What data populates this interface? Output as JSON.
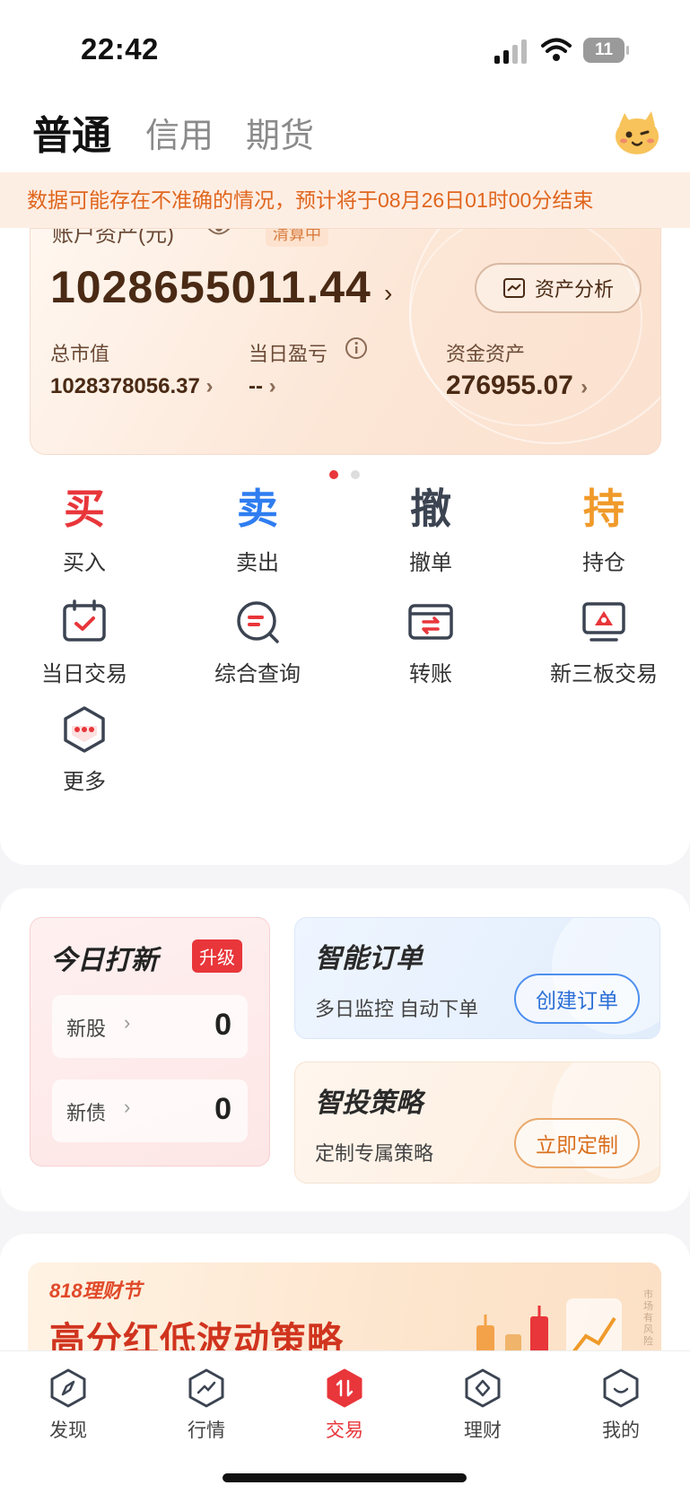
{
  "status_bar": {
    "time": "22:42",
    "battery": "11"
  },
  "top_tabs": [
    {
      "label": "普通",
      "active": true
    },
    {
      "label": "信用",
      "active": false
    },
    {
      "label": "期货",
      "active": false
    }
  ],
  "notice": "数据可能存在不准确的情况，预计将于08月26日01时00分结束",
  "asset_card": {
    "label": "账户资产(元)",
    "clearing_badge": "清算中",
    "total": "1028655011.44",
    "analysis_button": "资产分析",
    "stats": [
      {
        "label": "总市值",
        "value": "1028378056.37"
      },
      {
        "label": "当日盈亏",
        "value": "--"
      },
      {
        "label": "资金资产",
        "value": "276955.07"
      }
    ]
  },
  "pager": {
    "count": 2,
    "active_index": 0
  },
  "trade_actions": [
    {
      "glyph": "买",
      "label": "买入",
      "color": "#e8363a"
    },
    {
      "glyph": "卖",
      "label": "卖出",
      "color": "#2f7df0"
    },
    {
      "glyph": "撤",
      "label": "撤单",
      "color": "#3c4452"
    },
    {
      "glyph": "持",
      "label": "持仓",
      "color": "#f09a2a"
    }
  ],
  "functions": [
    {
      "label": "当日交易",
      "icon": "calendar-check-icon"
    },
    {
      "label": "综合查询",
      "icon": "search-query-icon"
    },
    {
      "label": "转账",
      "icon": "transfer-card-icon"
    },
    {
      "label": "新三板交易",
      "icon": "monitor-chart-icon"
    },
    {
      "label": "更多",
      "icon": "more-hexagon-icon"
    }
  ],
  "ipo_card": {
    "title": "今日打新",
    "badge": "升级",
    "rows": [
      {
        "label": "新股",
        "count": "0"
      },
      {
        "label": "新债",
        "count": "0"
      }
    ]
  },
  "smart_order": {
    "title": "智能订单",
    "subtitle": "多日监控 自动下单",
    "button": "创建订单"
  },
  "smart_strategy": {
    "title": "智投策略",
    "subtitle": "定制专属策略",
    "button": "立即定制"
  },
  "banner": {
    "tag": "818理财节",
    "title": "高分红低波动策略",
    "side_note": "市场有风险"
  },
  "bottom_nav": [
    {
      "label": "发现",
      "icon": "compass-icon",
      "active": false
    },
    {
      "label": "行情",
      "icon": "trend-icon",
      "active": false
    },
    {
      "label": "交易",
      "icon": "trade-icon",
      "active": true
    },
    {
      "label": "理财",
      "icon": "wealth-icon",
      "active": false
    },
    {
      "label": "我的",
      "icon": "profile-icon",
      "active": false
    }
  ],
  "colors": {
    "accent": "#e8363a",
    "notice_text": "#e0661e",
    "asset_text": "#4a2a14"
  }
}
